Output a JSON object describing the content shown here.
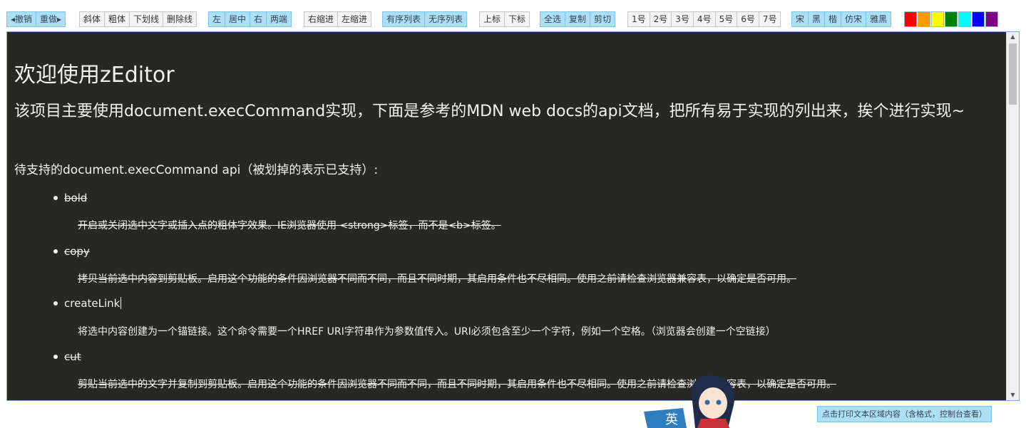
{
  "toolbar": {
    "groups": [
      {
        "name": "history",
        "buttons": [
          "◂撤销",
          "重做▸"
        ]
      },
      {
        "name": "font-style",
        "buttons": [
          "斜体",
          "粗体",
          "下划线",
          "删除线"
        ]
      },
      {
        "name": "align",
        "buttons": [
          "左",
          "居中",
          "右",
          "两端"
        ]
      },
      {
        "name": "indent",
        "buttons": [
          "右缩进",
          "左缩进"
        ]
      },
      {
        "name": "list",
        "buttons": [
          "有序列表",
          "无序列表"
        ]
      },
      {
        "name": "script",
        "buttons": [
          "上标",
          "下标"
        ]
      },
      {
        "name": "clipboard",
        "buttons": [
          "全选",
          "复制",
          "剪切"
        ]
      },
      {
        "name": "size",
        "buttons": [
          "1号",
          "2号",
          "3号",
          "4号",
          "5号",
          "6号",
          "7号"
        ]
      },
      {
        "name": "font-family",
        "buttons": [
          "宋",
          "黑",
          "楷",
          "仿宋",
          "雅黑"
        ]
      }
    ],
    "colors": [
      "#ff0000",
      "#ff9900",
      "#ffff00",
      "#008000",
      "#00ffff",
      "#0000ff",
      "#800080"
    ]
  },
  "editor": {
    "title": "欢迎使用zEditor",
    "subtitle": "该项目主要使用document.execCommand实现，下面是参考的MDN web docs的api文档，把所有易于实现的列出来，挨个进行实现~",
    "intro": "待支持的document.execCommand api（被划掉的表示已支持）:",
    "items": [
      {
        "name": "bold",
        "desc": "开启或关闭选中文字或插入点的粗体字效果。IE浏览器使用 <strong>标签，而不是<b>标签。",
        "done": true
      },
      {
        "name": "copy",
        "desc": "拷贝当前选中内容到剪贴板。启用这个功能的条件因浏览器不同而不同，而且不同时期，其启用条件也不尽相同。使用之前请检查浏览器兼容表，以确定是否可用。",
        "done": true
      },
      {
        "name": "createLink",
        "desc": "将选中内容创建为一个锚链接。这个命令需要一个HREF URI字符串作为参数值传入。URI必须包含至少一个字符，例如一个空格。（浏览器会创建一个空链接）",
        "done": false
      },
      {
        "name": "cut",
        "desc": "剪贴当前选中的文字并复制到剪贴板。启用这个功能的条件因浏览器不同而不同，而且不同时期，其启用条件也不尽相同。使用之前请检查浏览器兼容表，以确定是否可用。",
        "done": true
      }
    ]
  },
  "footer": {
    "print_label": "点击打印文本区域内容（含格式，控制台查看）",
    "mascot_badge": "英"
  }
}
